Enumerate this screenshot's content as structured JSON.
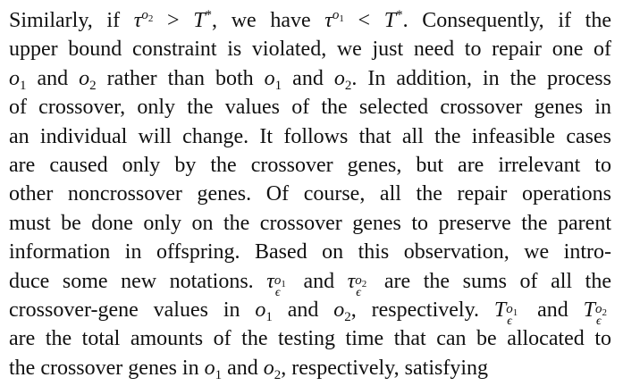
{
  "paragraph": {
    "line1": {
      "t1": "Similarly, if ",
      "tau": "τ",
      "sup_o2": "o",
      "sup_2": "2",
      "gt": " > ",
      "T": "T",
      "star": "*",
      "t2": ", we have ",
      "tau2": "τ",
      "sup_o1": "o",
      "sup_1": "1",
      "lt": " < ",
      "T2": "T",
      "star2": "*",
      "t3": ". Consequently, if the"
    },
    "line2": "upper bound constraint is violated, we just need to repair one of",
    "line3": {
      "o": "o",
      "sub1": "1",
      "and": " and ",
      "o2": "o",
      "sub2": "2",
      "t1": " rather than both ",
      "o3": "o",
      "sub3": "1",
      "and2": " and ",
      "o4": "o",
      "sub4": "2",
      "t2": ". In addition, in the process"
    },
    "line4": "of crossover, only the values of the selected crossover genes in",
    "line5": "an individual will change. It follows that all the infeasible cases",
    "line6": "are caused only by the crossover genes, but are irrelevant to",
    "line7": "other noncrossover genes. Of course, all the repair operations",
    "line8": "must be done only on the crossover genes to preserve the parent",
    "line9": "information in offspring. Based on this observation, we intro-",
    "line10": {
      "t1": "duce some new notations. ",
      "tau": "τ",
      "sup_a": "o",
      "sup_a1": "1",
      "eps": "ϵ",
      "and": " and ",
      "tau2": "τ",
      "sup_b": "o",
      "sup_b1": "2",
      "eps2": "ϵ",
      "t2": " are the sums of all the"
    },
    "line11": {
      "t1": "crossover-gene values in ",
      "o": "o",
      "sub1": "1",
      "and": " and ",
      "o2": "o",
      "sub2": "2",
      "t2": ", respectively. ",
      "T": "T",
      "sup_a": "o",
      "sup_a1": "1",
      "eps": "ϵ",
      "and2": " and ",
      "T2": "T",
      "sup_b": "o",
      "sup_b1": "2",
      "eps2": "ϵ"
    },
    "line12": "are the total amounts of the testing time that can be allocated to",
    "line13": {
      "t1": "the crossover genes in ",
      "o": "o",
      "sub1": "1",
      "and": " and ",
      "o2": "o",
      "sub2": "2",
      "t2": ", respectively, satisfying"
    }
  }
}
